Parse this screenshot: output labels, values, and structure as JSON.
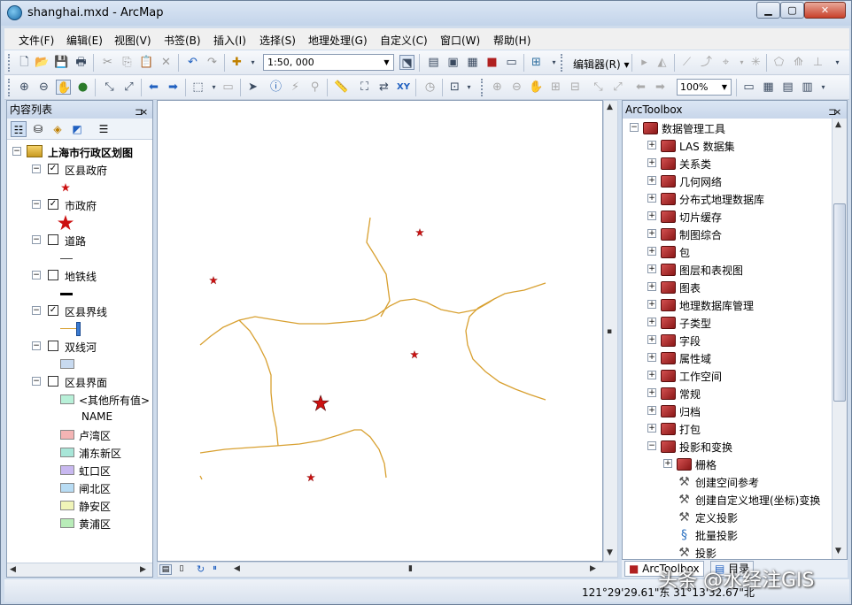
{
  "window": {
    "title": "shanghai.mxd - ArcMap",
    "min_label": "▁",
    "max_label": "▢",
    "close_label": "✕"
  },
  "menu": [
    {
      "label": "文件(F)"
    },
    {
      "label": "编辑(E)"
    },
    {
      "label": "视图(V)"
    },
    {
      "label": "书签(B)"
    },
    {
      "label": "插入(I)"
    },
    {
      "label": "选择(S)"
    },
    {
      "label": "地理处理(G)"
    },
    {
      "label": "自定义(C)"
    },
    {
      "label": "窗口(W)"
    },
    {
      "label": "帮助(H)"
    }
  ],
  "toolbar": {
    "scale_value": "1:50, 000",
    "editor_label": "编辑器(R) ▾",
    "zoom_value": "100%"
  },
  "toc": {
    "title": "内容列表",
    "pin": "ᅟ⊐",
    "close": "×",
    "root": "上海市行政区划图",
    "layers": [
      {
        "label": "区县政府",
        "checked": true
      },
      {
        "label": "市政府",
        "checked": true
      },
      {
        "label": "道路",
        "checked": false
      },
      {
        "label": "地铁线",
        "checked": false
      },
      {
        "label": "区县界线",
        "checked": true
      },
      {
        "label": "双线河",
        "checked": false
      },
      {
        "label": "区县界面",
        "checked": false
      }
    ],
    "symbols": {
      "other": "<其他所有值>",
      "field": "NAME",
      "classes": [
        {
          "label": "卢湾区",
          "color": "#f4b4b4"
        },
        {
          "label": "浦东新区",
          "color": "#a8e6d8"
        },
        {
          "label": "虹口区",
          "color": "#c8b8f0"
        },
        {
          "label": "闸北区",
          "color": "#b8dcf4"
        },
        {
          "label": "静安区",
          "color": "#f0f4b8"
        },
        {
          "label": "黄浦区",
          "color": "#b8ecb8"
        }
      ],
      "other_color": "#b8f0d8",
      "river_color": "#c8daf0",
      "boundary_color": "#d8a030",
      "point_color": "#cc1111"
    }
  },
  "toolbox": {
    "title": "ArcToolbox",
    "pin": "ᅟ⊐",
    "close": "×",
    "root": "数据管理工具",
    "toolsets": [
      "LAS 数据集",
      "关系类",
      "几何网络",
      "分布式地理数据库",
      "切片缓存",
      "制图综合",
      "包",
      "图层和表视图",
      "图表",
      "地理数据库管理",
      "子类型",
      "字段",
      "属性域",
      "工作空间",
      "常规",
      "归档",
      "打包"
    ],
    "expanded_toolset": "投影和变换",
    "sub_toolset": "栅格",
    "tools": [
      "创建空间参考",
      "创建自定义地理(坐标)变换",
      "定义投影",
      "批量投影",
      "投影"
    ],
    "tabs": [
      "ArcToolbox",
      "目录"
    ]
  },
  "status": {
    "coords": "121°29'29.61\"东  31°13'32.67\"北"
  },
  "watermark": "头条 @水经注GIS"
}
